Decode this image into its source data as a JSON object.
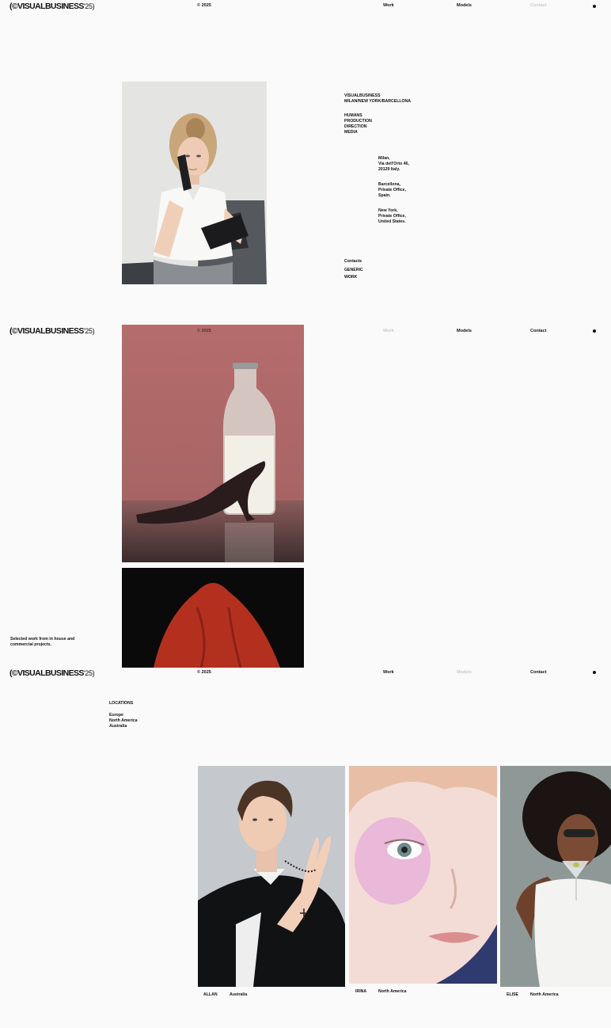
{
  "brand": {
    "name": "VISUALBUSINESS",
    "prefix": "(©",
    "suffix": "'25)"
  },
  "year": "© 2025",
  "nav": {
    "work": "Work",
    "models": "Models",
    "contact": "Contact"
  },
  "about": {
    "company": "VISUALBUSINESS",
    "cities": "MILAN/NEW YORK/BARCELLONA",
    "services": [
      "HUMANS",
      "PRODUCTION",
      "DIRECTION",
      "MEDIA"
    ],
    "offices": [
      [
        "Milan,",
        "Via dell'Orto 46,",
        "20129 Italy."
      ],
      [
        "Barcellona,",
        "Private Office,",
        "Spain."
      ],
      [
        "New York,",
        "Private Office,",
        "United States."
      ]
    ],
    "contacts_label": "Contacts",
    "links": [
      "GENERIC",
      "WORK"
    ]
  },
  "work": {
    "caption": [
      "Selected work from in house and",
      "commercial projects."
    ]
  },
  "models": {
    "locations_label": "LOCATIONS",
    "locations": [
      "Europe",
      "North America",
      "Australia"
    ],
    "list": [
      {
        "name": "ALLAN",
        "location": "Australia"
      },
      {
        "name": "IRINA",
        "location": "North America"
      },
      {
        "name": "ELISE",
        "location": "North America"
      }
    ]
  }
}
